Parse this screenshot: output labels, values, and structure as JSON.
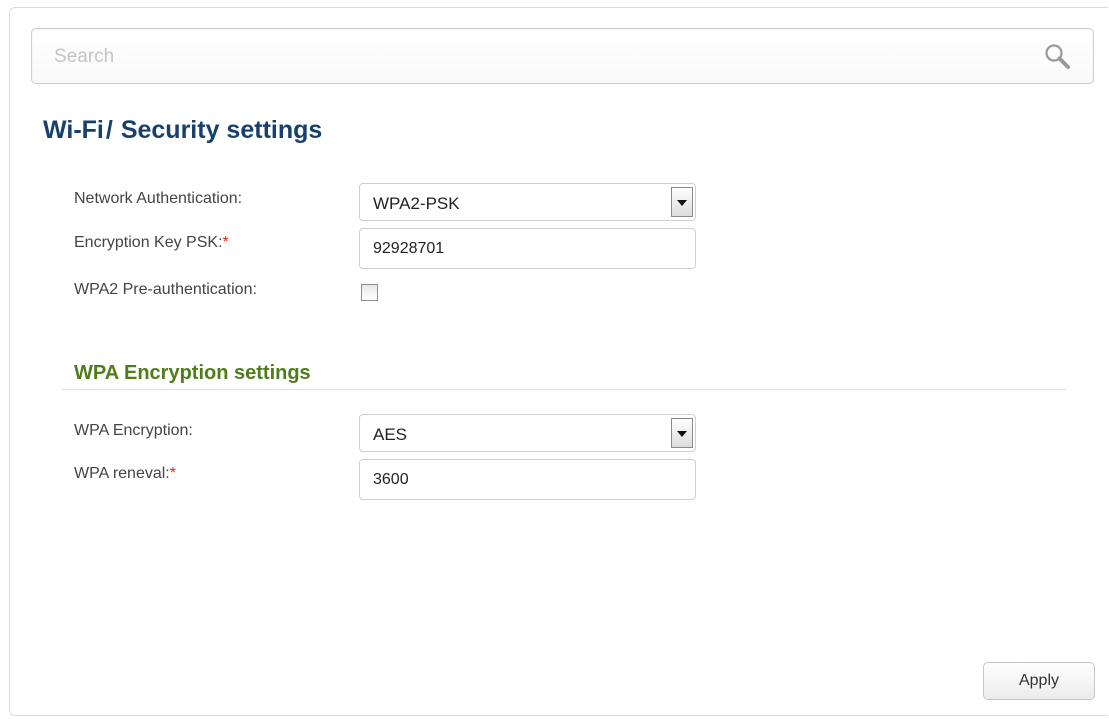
{
  "search": {
    "placeholder": "Search",
    "icon": "search-icon"
  },
  "header": {
    "section": "Wi-Fi",
    "separator": "/",
    "title": "Security settings"
  },
  "security": {
    "network_auth_label": "Network Authentication:",
    "network_auth_value": "WPA2-PSK",
    "psk_label": "Encryption Key PSK:",
    "psk_value": "92928701",
    "preauth_label": "WPA2 Pre-authentication:",
    "preauth_checked": false
  },
  "wpa": {
    "section_title": "WPA Encryption settings",
    "encryption_label": "WPA Encryption:",
    "encryption_value": "AES",
    "renewal_label": "WPA reneval:",
    "renewal_value": "3600"
  },
  "required_marker": "*",
  "actions": {
    "apply_label": "Apply"
  },
  "colors": {
    "title": "#17406b",
    "section_title": "#4f7d1a",
    "required": "#e0261b"
  }
}
